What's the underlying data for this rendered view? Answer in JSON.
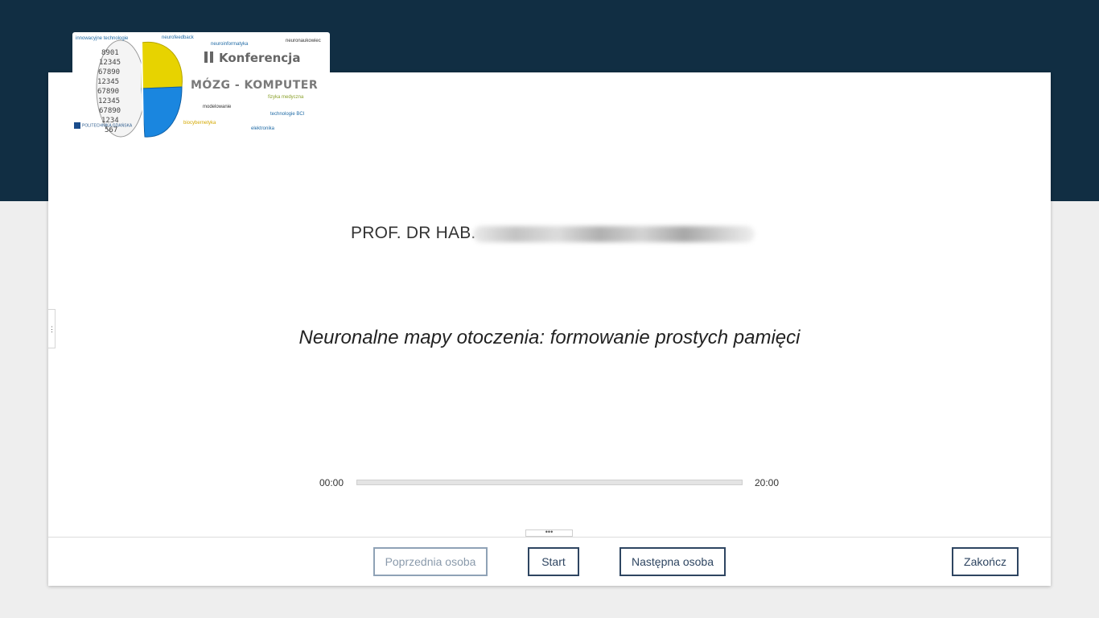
{
  "logo": {
    "title": "Konferencja",
    "main": "MÓZG - KOMPUTER",
    "tags": [
      {
        "text": "innowacyjne technologie",
        "color": "#1f6aa5"
      },
      {
        "text": "neurofeedback",
        "color": "#1f6aa5"
      },
      {
        "text": "neuroinformatyka",
        "color": "#1f6aa5"
      },
      {
        "text": "neuronaukowiec",
        "color": "#333333"
      },
      {
        "text": "fizyka medyczna",
        "color": "#8aa02a"
      },
      {
        "text": "modelowanie",
        "color": "#333333"
      },
      {
        "text": "technologie BCI",
        "color": "#1f6aa5"
      },
      {
        "text": "biocybernetyka",
        "color": "#d4a800"
      },
      {
        "text": "elektronika",
        "color": "#1f6aa5"
      }
    ],
    "org": "POLITECHNIKA GDAŃSKA",
    "colors": {
      "yellow": "#e7d300",
      "blue": "#1a86df"
    }
  },
  "presentation": {
    "speaker": "PROF. DR HAB.",
    "title": "Neuronalne mapy otoczenia: formowanie prostych pamięci"
  },
  "timer": {
    "start": "00:00",
    "end": "20:00",
    "progress": 0
  },
  "handles": {
    "side": "⋮",
    "bottom": "•••"
  },
  "buttons": {
    "previous": "Poprzednia osoba",
    "start": "Start",
    "next": "Następna osoba",
    "finish": "Zakończ"
  },
  "colors": {
    "header": "#112e43",
    "accent": "#2e4561"
  }
}
